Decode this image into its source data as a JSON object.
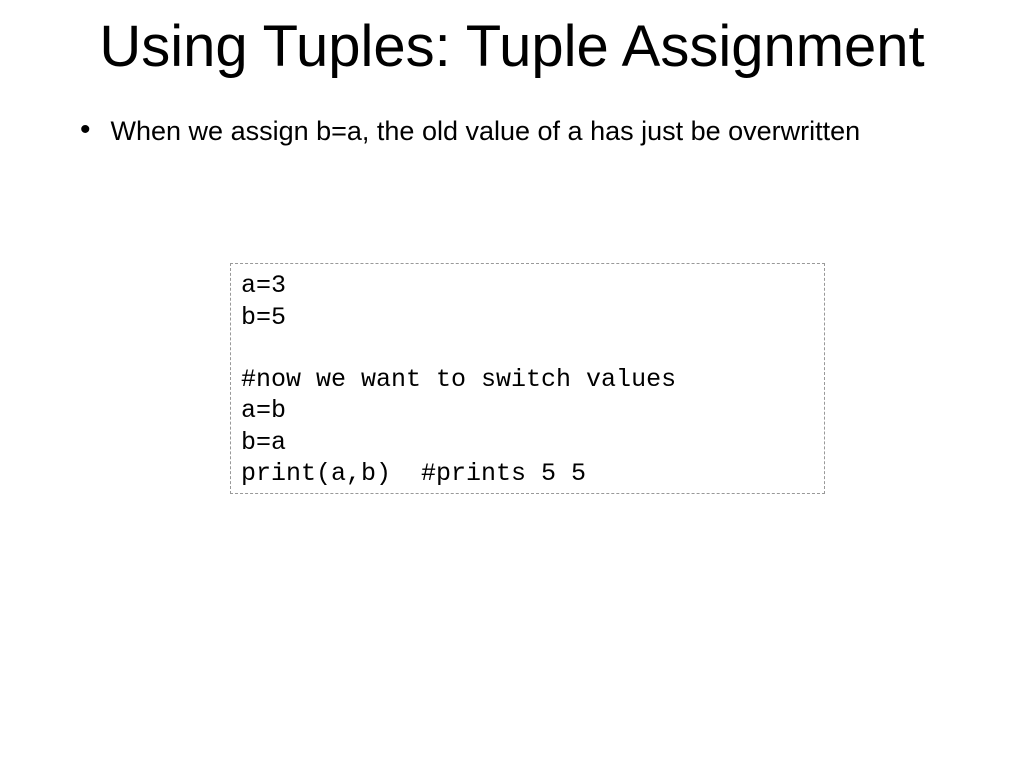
{
  "title": "Using Tuples: Tuple Assignment",
  "bullet1": "When we assign b=a, the old value of a has just be overwritten",
  "code": "a=3\nb=5\n\n#now we want to switch values\na=b\nb=a\nprint(a,b)  #prints 5 5"
}
